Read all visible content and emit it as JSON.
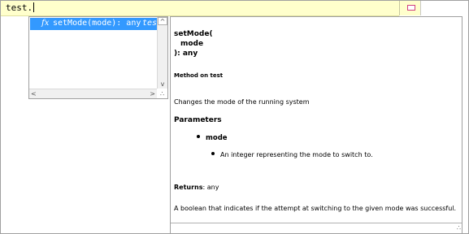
{
  "editor": {
    "line_text": "test."
  },
  "proposals": {
    "items": [
      {
        "icon": "fx",
        "signature": "setMode(mode): any",
        "owner": "test"
      }
    ]
  },
  "doc": {
    "signature_line1": "setMode(",
    "signature_line2": "mode",
    "signature_line3": "): any",
    "owner": "Method on test",
    "description": "Changes the mode of the running system",
    "params_heading": "Parameters",
    "params": [
      {
        "name": "mode",
        "description": "An integer representing the mode to switch to."
      }
    ],
    "returns_label": "Returns",
    "returns_value": ": any",
    "result_text": "A boolean that indicates if the attempt at switching to the given mode was successful."
  },
  "colors": {
    "selection": "#3399ff",
    "current_line": "#ffffcc",
    "marker": "#d04080"
  }
}
